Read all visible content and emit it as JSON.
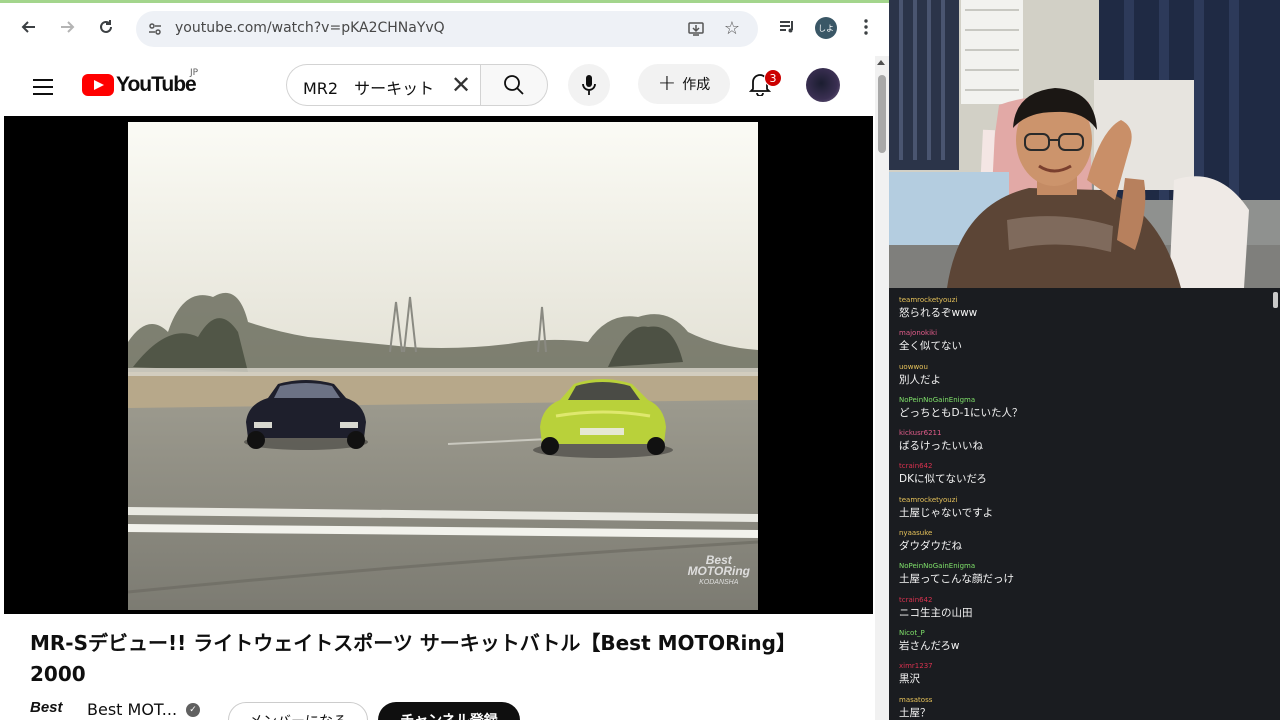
{
  "browser": {
    "url": "youtube.com/watch?v=pKA2CHNaYvQ",
    "profile_initials": "しよ"
  },
  "youtube": {
    "logo_text": "YouTube",
    "region": "JP",
    "search_query": "MR2　サーキット",
    "create_label": "作成",
    "notification_count": "3"
  },
  "video": {
    "title": "MR-Sデビュー!! ライトウェイトスポーツ サーキットバトル【Best MOTORing】2000",
    "watermark_line1": "Best",
    "watermark_line2": "MOTORing",
    "watermark_line3": "KODANSHA"
  },
  "channel": {
    "logo_text": "Best",
    "name": "Best MOT...",
    "join_label": "メンバーになる",
    "subscribe_label": "チャンネル登録"
  },
  "chat": {
    "messages": [
      {
        "user": "teamrocketyouzi",
        "text": "怒られるぞwww",
        "color": "#e6c25a"
      },
      {
        "user": "majonokiki",
        "text": "全く似てない",
        "color": "#e25c8a"
      },
      {
        "user": "uowwou",
        "text": "別人だよ",
        "color": "#e6c25a"
      },
      {
        "user": "NoPeinNoGainEnigma",
        "text": "どっちともD-1にいた人？",
        "color": "#7fe06a"
      },
      {
        "user": "kickusr6211",
        "text": "ばるけったいいね",
        "color": "#e25c8a"
      },
      {
        "user": "tcrain642",
        "text": "DKに似てないだろ",
        "color": "#d9324f"
      },
      {
        "user": "teamrocketyouzi",
        "text": "土屋じゃないですよ",
        "color": "#e6c25a"
      },
      {
        "user": "nyaasuke",
        "text": "ダウダウだね",
        "color": "#e6c25a"
      },
      {
        "user": "NoPeinNoGainEnigma",
        "text": "土屋ってこんな顔だっけ",
        "color": "#7fe06a"
      },
      {
        "user": "tcrain642",
        "text": "ニコ生主の山田",
        "color": "#d9324f"
      },
      {
        "user": "Nicot_P",
        "text": "岩さんだろw",
        "color": "#7fe06a"
      },
      {
        "user": "ximr1237",
        "text": "黒沢",
        "color": "#d9324f"
      },
      {
        "user": "masatoss",
        "text": "土屋？",
        "color": "#e6c25a"
      }
    ]
  }
}
